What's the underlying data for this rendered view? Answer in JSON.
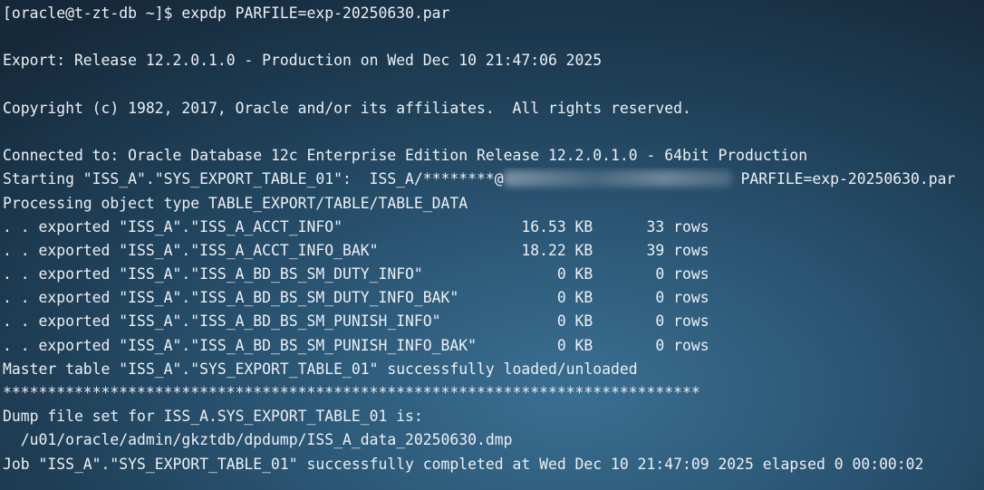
{
  "terminal": {
    "prompt": "[oracle@t-zt-db ~]$ ",
    "command": "expdp PARFILE=exp-20250630.par",
    "release_line": "Export: Release 12.2.0.1.0 - Production on Wed Dec 10 21:47:06 2025",
    "copyright_line": "Copyright (c) 1982, 2017, Oracle and/or its affiliates.  All rights reserved.",
    "connected_line": "Connected to: Oracle Database 12c Enterprise Edition Release 12.2.0.1.0 - 64bit Production",
    "starting_prefix": "Starting \"ISS_A\".\"SYS_EXPORT_TABLE_01\":  ISS_A/********@",
    "starting_suffix": " PARFILE=exp-20250630.par",
    "processing_line": "Processing object type TABLE_EXPORT/TABLE/TABLE_DATA",
    "exports": [
      ". . exported \"ISS_A\".\"ISS_A_ACCT_INFO\"                    16.53 KB      33 rows",
      ". . exported \"ISS_A\".\"ISS_A_ACCT_INFO_BAK\"                18.22 KB      39 rows",
      ". . exported \"ISS_A\".\"ISS_A_BD_BS_SM_DUTY_INFO\"               0 KB       0 rows",
      ". . exported \"ISS_A\".\"ISS_A_BD_BS_SM_DUTY_INFO_BAK\"           0 KB       0 rows",
      ". . exported \"ISS_A\".\"ISS_A_BD_BS_SM_PUNISH_INFO\"             0 KB       0 rows",
      ". . exported \"ISS_A\".\"ISS_A_BD_BS_SM_PUNISH_INFO_BAK\"         0 KB       0 rows"
    ],
    "master_line": "Master table \"ISS_A\".\"SYS_EXPORT_TABLE_01\" successfully loaded/unloaded",
    "separator": "******************************************************************************",
    "dump_header": "Dump file set for ISS_A.SYS_EXPORT_TABLE_01 is:",
    "dump_path": "  /u01/oracle/admin/gkztdb/dpdump/ISS_A_data_20250630.dmp",
    "job_line": "Job \"ISS_A\".\"SYS_EXPORT_TABLE_01\" successfully completed at Wed Dec 10 21:47:09 2025 elapsed 0 00:00:02"
  }
}
